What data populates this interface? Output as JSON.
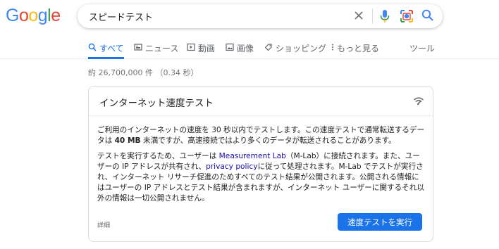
{
  "logo": {
    "letters": [
      "G",
      "o",
      "o",
      "g",
      "l",
      "e"
    ],
    "colors": [
      "#4285f4",
      "#ea4335",
      "#fbbc05",
      "#4285f4",
      "#34a853",
      "#ea4335"
    ]
  },
  "search": {
    "query": "スピードテスト",
    "icons": [
      "clear-icon",
      "mic-icon",
      "lens-icon",
      "search-icon"
    ]
  },
  "tabs": [
    {
      "label": "すべて",
      "icon": "search-icon",
      "active": true
    },
    {
      "label": "ニュース",
      "icon": "news-icon",
      "active": false
    },
    {
      "label": "動画",
      "icon": "video-icon",
      "active": false
    },
    {
      "label": "画像",
      "icon": "image-icon",
      "active": false
    },
    {
      "label": "ショッピング",
      "icon": "tag-icon",
      "active": false
    },
    {
      "label": "もっと見る",
      "icon": "more-vert-icon",
      "active": false
    }
  ],
  "tools_label": "ツール",
  "result_stats": "約 26,700,000 件 （0.34 秒）",
  "card": {
    "title": "インターネット速度テスト",
    "p1": {
      "t1": "ご利用のインターネットの速度を 30 秒以内でテストします。この速度テストで通常転送するデータは ",
      "bold": "40 MB",
      "t2": " 未満ですが、高速接続ではより多くのデータが転送されることがあります。"
    },
    "p2": {
      "t1": "テストを実行するため、ユーザーは ",
      "link1": "Measurement Lab",
      "t2": "（M-Lab）に接続されます。また、ユーザーの IP アドレスが共有され、",
      "link2": "privacy policy",
      "t3": "に従って処理されます。M-Lab でテストが実行され、インターネット リサーチ促進のためすべてのテスト結果が公開されます。公開される情報にはユーザーの IP アドレスとテスト結果が含まれますが、インターネット ユーザーに関するそれ以外の情報は一切公開されません。"
    },
    "details_label": "詳細",
    "run_button": "速度テストを実行"
  },
  "colors": {
    "accent": "#1a73e8",
    "link": "#1a0dab",
    "muted": "#70757a"
  }
}
